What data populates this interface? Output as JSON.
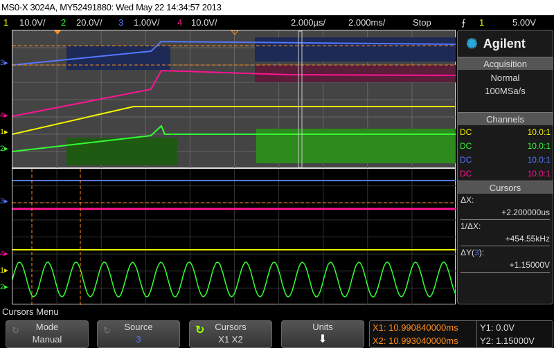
{
  "title": "MS0-X 3024A, MY52491880: Wed May 22 14:34:57 2013",
  "status": {
    "channels": [
      {
        "num": "1",
        "scale": "10.0V/",
        "color": "#f5f500"
      },
      {
        "num": "2",
        "scale": "20.0V/",
        "color": "#33ff33"
      },
      {
        "num": "3",
        "scale": "1.00V/",
        "color": "#5577ff"
      },
      {
        "num": "4",
        "scale": "10.0V/",
        "color": "#ff1493"
      }
    ],
    "zoom_timebase": "2.000µs/",
    "main_timebase": "2.000ms/",
    "run_state": "Stop",
    "trigger_icon": "rising-edge-icon",
    "trigger_source": "1",
    "trigger_level": "5.00V"
  },
  "panel": {
    "brand": "Agilent",
    "acquisition": {
      "header": "Acquisition",
      "mode": "Normal",
      "rate": "100MSa/s"
    },
    "channels": {
      "header": "Channels",
      "rows": [
        {
          "coupling": "DC",
          "probe": "10.0:1",
          "color": "#f5f500"
        },
        {
          "coupling": "DC",
          "probe": "10.0:1",
          "color": "#33ff33"
        },
        {
          "coupling": "DC",
          "probe": "10.0:1",
          "color": "#5577ff"
        },
        {
          "coupling": "DC",
          "probe": "10.0:1",
          "color": "#ff1493"
        }
      ]
    },
    "cursors": {
      "header": "Cursors",
      "dx_label": "ΔX:",
      "dx": "+2.200000us",
      "inv_label": "1/ΔX:",
      "inv": "+454.55kHz",
      "dy_label_pre": "ΔY(",
      "dy_ch": "3",
      "dy_label_post": "):",
      "dy": "+1.15000V"
    }
  },
  "markers": {
    "ch1": "1",
    "ch2": "2",
    "ch3": "3",
    "ch4": "4"
  },
  "menu": {
    "title": "Cursors Menu",
    "mode": {
      "label": "Mode",
      "value": "Manual"
    },
    "source": {
      "label": "Source",
      "value": "3"
    },
    "cursors": {
      "label": "Cursors",
      "value": "X1 X2"
    },
    "units": {
      "label": "Units"
    },
    "x1": "X1: 10.990840000ms",
    "x2": "X2: 10.993040000ms",
    "y1": "Y1: 0.0V",
    "y2": "Y2: 1.15000V"
  }
}
